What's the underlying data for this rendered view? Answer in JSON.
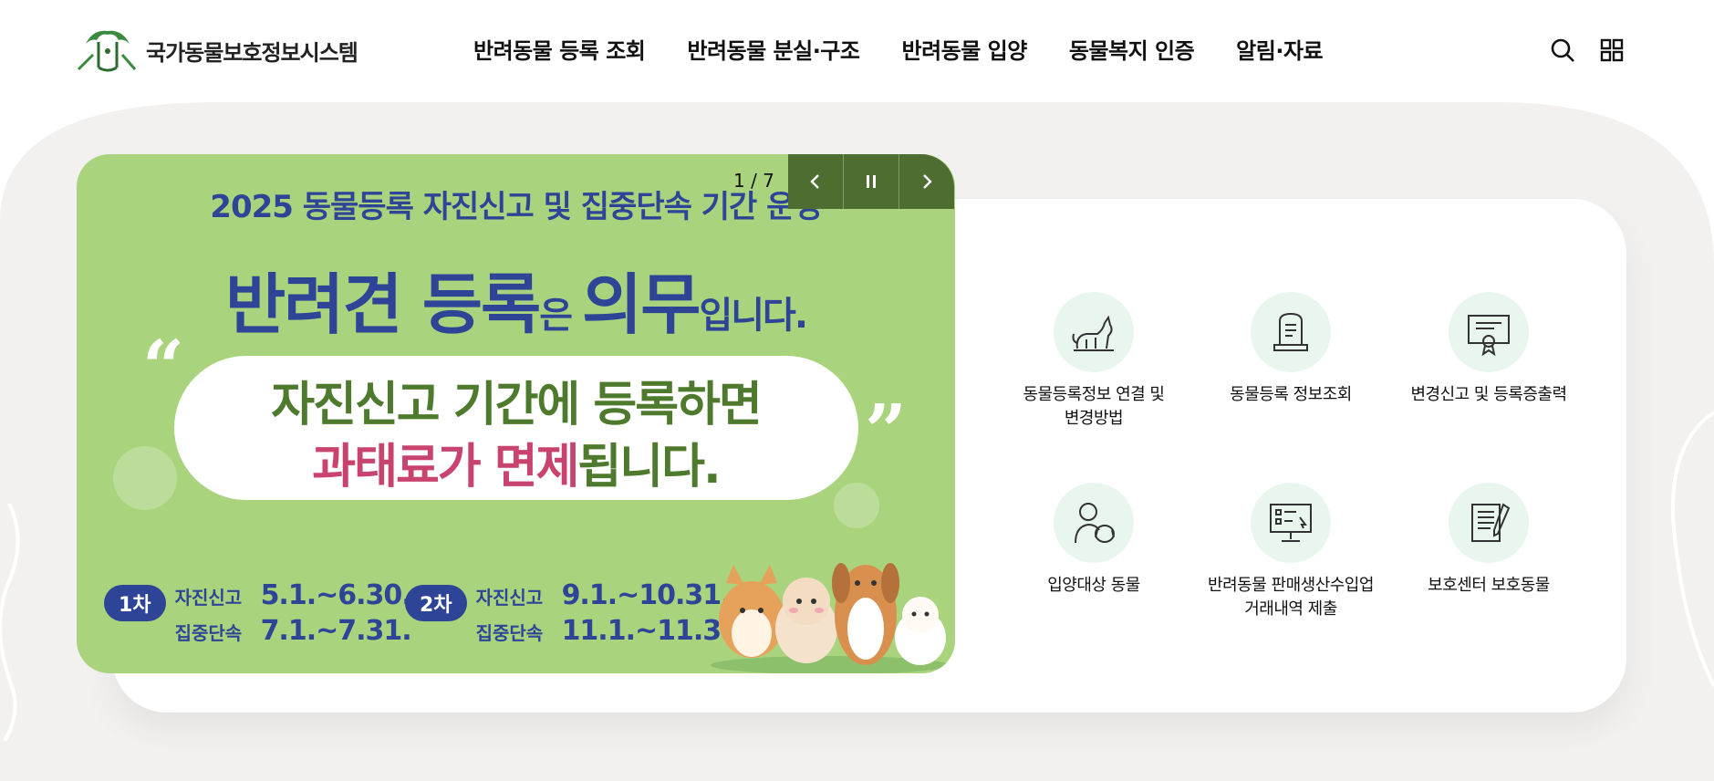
{
  "header": {
    "logo_text": "국가동물보호정보시스템",
    "nav": [
      {
        "label": "반려동물 등록 조회"
      },
      {
        "label": "반려동물 분실·구조"
      },
      {
        "label": "반려동물 입양"
      },
      {
        "label": "동물복지 인증"
      },
      {
        "label": "알림·자료"
      }
    ],
    "search_icon": "search-icon",
    "menu_icon": "grid-menu-icon"
  },
  "banner": {
    "title": "2025 동물등록 자진신고 및 집중단속 기간 운영",
    "headline_1": "반려견 등록",
    "headline_2": "은 ",
    "headline_3": "의무",
    "headline_4": "입니다.",
    "quote_open": "“",
    "quote_close": "”",
    "line1": "자진신고 기간에 등록하면",
    "line2_pink": "과태료가 면제",
    "line2_green": "됩니다.",
    "schedule": [
      {
        "badge": "1차",
        "rows": [
          {
            "label": "자진신고",
            "value": "5.1.~6.30."
          },
          {
            "label": "집중단속",
            "value": "7.1.~7.31."
          }
        ]
      },
      {
        "badge": "2차",
        "rows": [
          {
            "label": "자진신고",
            "value": "9.1.~10.31."
          },
          {
            "label": "집중단속",
            "value": "11.1.~11.30."
          }
        ]
      }
    ]
  },
  "slider": {
    "counter": "1 / 7",
    "prev_icon": "chevron-left-icon",
    "pause_icon": "pause-icon",
    "next_icon": "chevron-right-icon"
  },
  "quick_menu": [
    {
      "label": "동물등록정보 연결 및\n변경방법",
      "icon": "cat-icon"
    },
    {
      "label": "동물등록 정보조회",
      "icon": "tombstone-document-icon"
    },
    {
      "label": "변경신고 및 등록증출력",
      "icon": "certificate-icon"
    },
    {
      "label": "입양대상 동물",
      "icon": "person-with-dog-icon"
    },
    {
      "label": "반려동물 판매생산수입업\n거래내역 제출",
      "icon": "monitor-checklist-icon"
    },
    {
      "label": "보호센터 보호동물",
      "icon": "notepad-pen-icon"
    }
  ],
  "colors": {
    "brand_green": "#4e6e31",
    "banner_bg": "#a9d47d",
    "navy": "#2e4597",
    "pink": "#c8436d",
    "icon_bg": "#e8f6ee"
  }
}
